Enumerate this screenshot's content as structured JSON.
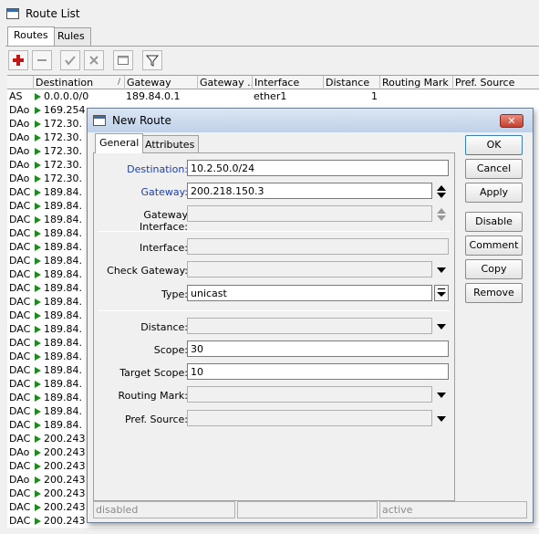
{
  "window": {
    "title": "Route List"
  },
  "tabs": [
    "Routes",
    "Rules"
  ],
  "toolbar": {
    "add": "add-icon",
    "remove": "remove-icon",
    "enable": "check-icon",
    "disable": "cross-icon",
    "comment": "comment-icon",
    "filter": "filter-icon"
  },
  "table": {
    "columns": [
      "Destination",
      "Gateway",
      "Gateway ...",
      "Interface",
      "Distance",
      "Routing Mark",
      "Pref. Source"
    ],
    "rows": [
      {
        "flags": "AS",
        "destination": "0.0.0.0/0",
        "gateway": "189.84.0.1",
        "interface": "ether1",
        "distance": "1"
      },
      {
        "flags": "DAo",
        "destination": "169.254"
      },
      {
        "flags": "DAo",
        "destination": "172.30."
      },
      {
        "flags": "DAo",
        "destination": "172.30."
      },
      {
        "flags": "DAo",
        "destination": "172.30."
      },
      {
        "flags": "DAo",
        "destination": "172.30."
      },
      {
        "flags": "DAo",
        "destination": "172.30."
      },
      {
        "flags": "DAC",
        "destination": "189.84."
      },
      {
        "flags": "DAC",
        "destination": "189.84."
      },
      {
        "flags": "DAC",
        "destination": "189.84."
      },
      {
        "flags": "DAC",
        "destination": "189.84."
      },
      {
        "flags": "DAC",
        "destination": "189.84."
      },
      {
        "flags": "DAC",
        "destination": "189.84."
      },
      {
        "flags": "DAC",
        "destination": "189.84."
      },
      {
        "flags": "DAC",
        "destination": "189.84."
      },
      {
        "flags": "DAC",
        "destination": "189.84."
      },
      {
        "flags": "DAC",
        "destination": "189.84."
      },
      {
        "flags": "DAC",
        "destination": "189.84."
      },
      {
        "flags": "DAC",
        "destination": "189.84."
      },
      {
        "flags": "DAC",
        "destination": "189.84."
      },
      {
        "flags": "DAC",
        "destination": "189.84."
      },
      {
        "flags": "DAC",
        "destination": "189.84."
      },
      {
        "flags": "DAC",
        "destination": "189.84."
      },
      {
        "flags": "DAC",
        "destination": "189.84."
      },
      {
        "flags": "DAC",
        "destination": "189.84."
      },
      {
        "flags": "DAC",
        "destination": "200.243"
      },
      {
        "flags": "DAo",
        "destination": "200.243"
      },
      {
        "flags": "DAC",
        "destination": "200.243"
      },
      {
        "flags": "DAo",
        "destination": "200.243"
      },
      {
        "flags": "DAC",
        "destination": "200.243"
      },
      {
        "flags": "DAC",
        "destination": "200.243"
      },
      {
        "flags": "DAC",
        "destination": "200.243"
      }
    ]
  },
  "dialog": {
    "title": "New Route",
    "tabs": [
      "General",
      "Attributes"
    ],
    "fields": {
      "destination": {
        "label": "Destination:",
        "value": "10.2.50.0/24"
      },
      "gateway": {
        "label": "Gateway:",
        "value": "200.218.150.3"
      },
      "gateway_interface": {
        "label": "Gateway Interface:",
        "value": ""
      },
      "interface": {
        "label": "Interface:",
        "value": ""
      },
      "check_gateway": {
        "label": "Check Gateway:",
        "value": ""
      },
      "type": {
        "label": "Type:",
        "value": "unicast"
      },
      "distance": {
        "label": "Distance:",
        "value": ""
      },
      "scope": {
        "label": "Scope:",
        "value": "30"
      },
      "target_scope": {
        "label": "Target Scope:",
        "value": "10"
      },
      "routing_mark": {
        "label": "Routing Mark:",
        "value": ""
      },
      "pref_source": {
        "label": "Pref. Source:",
        "value": ""
      }
    },
    "buttons": [
      "OK",
      "Cancel",
      "Apply",
      "Disable",
      "Comment",
      "Copy",
      "Remove"
    ],
    "status": [
      "disabled",
      "",
      "active"
    ],
    "close_icon": "close-icon"
  }
}
